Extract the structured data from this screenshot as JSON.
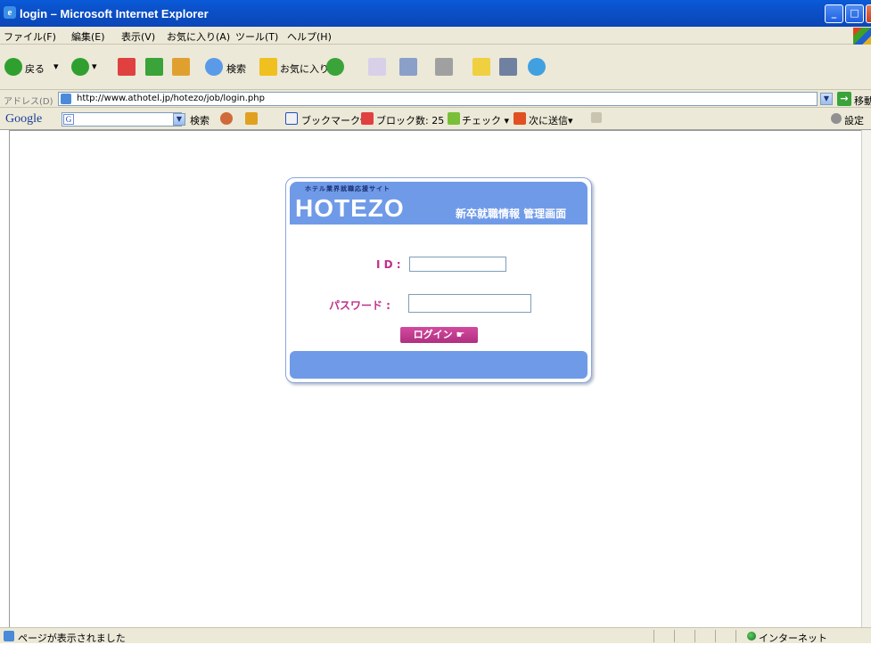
{
  "window": {
    "title": "login – Microsoft Internet Explorer"
  },
  "menu": [
    "ファイル(F)",
    "編集(E)",
    "表示(V)",
    "お気に入り(A)",
    "ツール(T)",
    "ヘルプ(H)"
  ],
  "toolbar": {
    "back": "戻る",
    "search": "検索",
    "favorites": "お気に入り"
  },
  "address": {
    "label": "アドレス(D)",
    "url": "http://www.athotel.jp/hotezo/job/login.php",
    "go": "移動"
  },
  "google": {
    "logo": "Google",
    "search": "検索",
    "bookmarks": "ブックマーク▾",
    "blocked": "ブロック数: 25",
    "check": "チェック ▾",
    "send": "次に送信▾",
    "settings": "設定"
  },
  "page": {
    "tagline": "ホテル業界就職応援サイト",
    "logo": "HOTEZO",
    "subtitle": "新卒就職情報 管理画面",
    "id_label": "I D :",
    "password_label": "パスワード :",
    "id_value": "",
    "password_value": "",
    "login_label": "ログイン ☛"
  },
  "status": {
    "text": "ページが表示されました",
    "zone": "インターネット"
  },
  "colors": {
    "header_blue": "#6f9ae8",
    "label_magenta": "#c0308a",
    "button_magenta": "#b0307f"
  }
}
